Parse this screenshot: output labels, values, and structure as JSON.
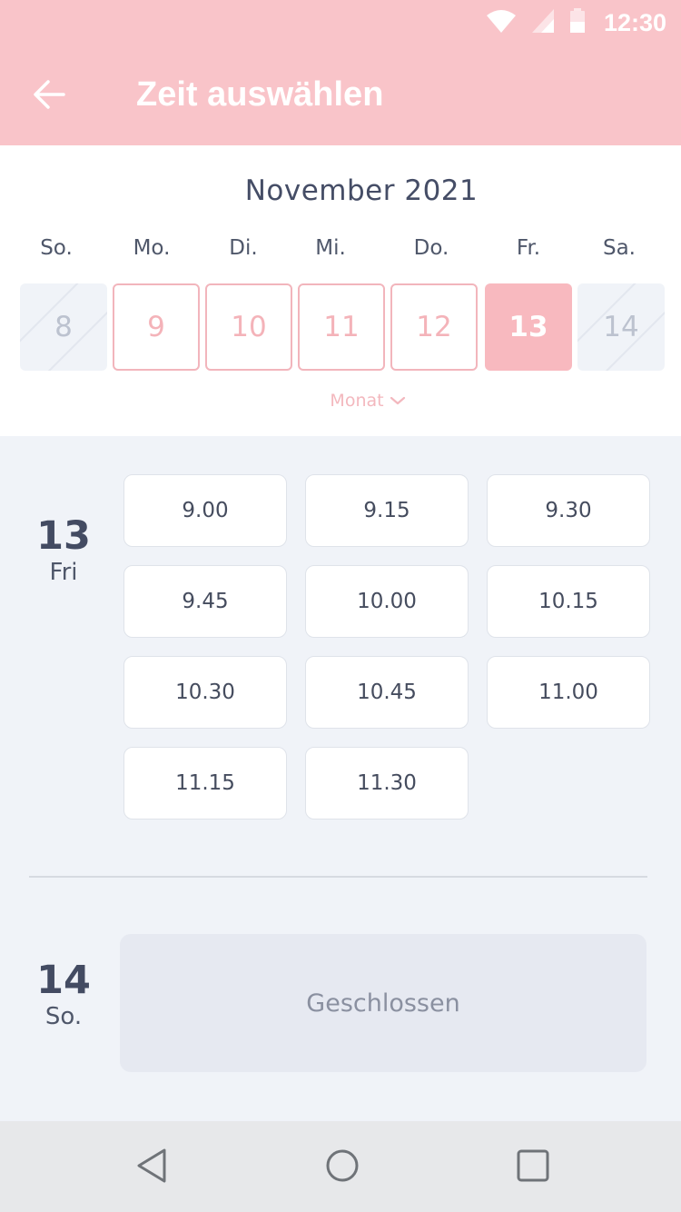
{
  "status_bar": {
    "time": "12:30",
    "icons": [
      "wifi-icon",
      "cellular-signal-icon",
      "battery-icon"
    ]
  },
  "header": {
    "title": "Zeit auswählen",
    "back_icon": "arrow-left-icon"
  },
  "calendar": {
    "month_label": "November 2021",
    "weekdays": [
      "So.",
      "Mo.",
      "Di.",
      "Mi.",
      "Do.",
      "Fr.",
      "Sa."
    ],
    "days": [
      {
        "label": "8",
        "state": "disabled"
      },
      {
        "label": "9",
        "state": "available"
      },
      {
        "label": "10",
        "state": "available"
      },
      {
        "label": "11",
        "state": "available"
      },
      {
        "label": "12",
        "state": "available"
      },
      {
        "label": "13",
        "state": "selected"
      },
      {
        "label": "14",
        "state": "disabled"
      }
    ],
    "month_toggle_label": "Monat",
    "month_toggle_icon": "chevron-down-icon"
  },
  "schedule": [
    {
      "day_number": "13",
      "day_name": "Fri",
      "slots": [
        "9.00",
        "9.15",
        "9.30",
        "9.45",
        "10.00",
        "10.15",
        "10.30",
        "10.45",
        "11.00",
        "11.15",
        "11.30"
      ]
    },
    {
      "day_number": "14",
      "day_name": "So.",
      "closed_label": "Geschlossen"
    }
  ],
  "nav_bar": {
    "icons": [
      "back-triangle-icon",
      "home-circle-icon",
      "recents-square-icon"
    ]
  },
  "colors": {
    "accent_pink": "#f9c4c9",
    "selected_day": "#f8b9bf",
    "available_border": "#f2b5bc",
    "page_background": "#f0f3f8",
    "closed_background": "#e6e9f1",
    "heading_text": "#434b62"
  }
}
